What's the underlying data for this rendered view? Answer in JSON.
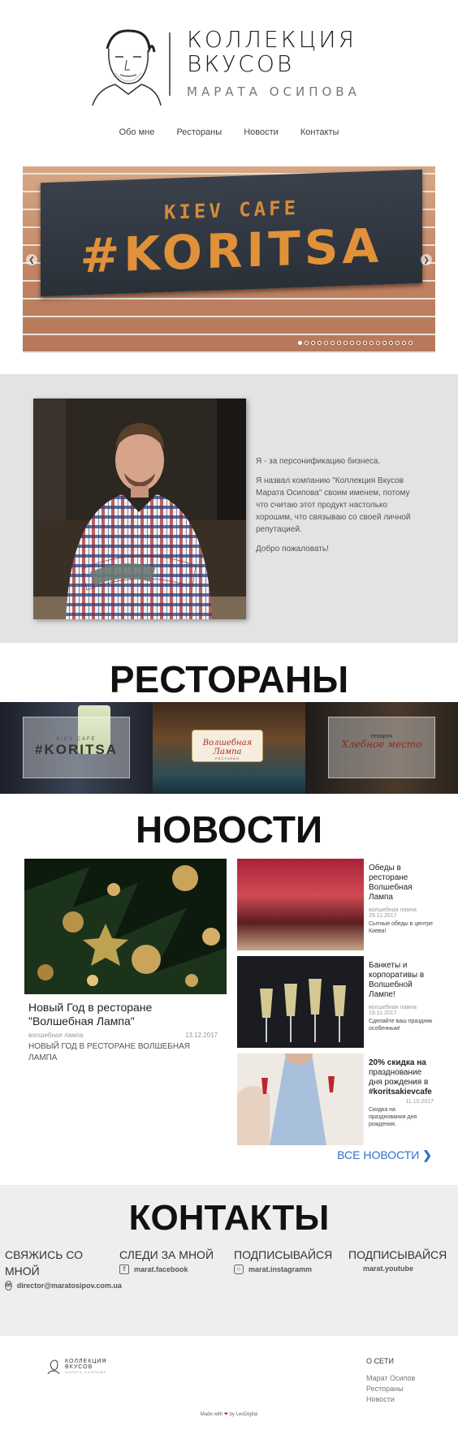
{
  "header": {
    "logo_line1": "КОЛЛЕКЦИЯ",
    "logo_line2": "ВКУСОВ",
    "logo_sub": "МАРАТА ОСИПОВА",
    "nav": [
      "Обо мне",
      "Рестораны",
      "Новости",
      "Контакты"
    ]
  },
  "slider": {
    "sign_small": "KIEV CAFE",
    "sign_big": "#KORITSA",
    "prev_icon": "chevron-left-icon",
    "next_icon": "chevron-right-icon",
    "dots_count": 18,
    "active_dot": 0
  },
  "about": {
    "p1": "Я - за персонификацию бизнеса.",
    "p2": "Я назвал компанию \"Коллекция Вкусов Марата Осипова\" своим именем, потому что считаю этот продукт настолько хорошим, что связываю со своей личной репутацией.",
    "p3": "Добро пожаловать!"
  },
  "restaurants": {
    "title": "РЕСТОРАНЫ",
    "items": [
      {
        "small": "KIEV CAFE",
        "big": "#KORITSA"
      },
      {
        "big": "Волшебная Лампа",
        "small": "РЕСТОРАН"
      },
      {
        "small": "пекарня",
        "big": "Хлебное место"
      }
    ]
  },
  "news": {
    "title": "НОВОСТИ",
    "main": {
      "title": "Новый Год в ресторане \"Волшебная Лампа\"",
      "source": "волшебная лампа",
      "date": "13.12.2017",
      "desc": "НОВЫЙ ГОД В РЕСТОРАНЕ ВОЛШЕБНАЯ ЛАМПА"
    },
    "side": [
      {
        "title": "Обеды в ресторане Волшебная Лампа",
        "source": "волшебная лампа",
        "date": "29.11.2017",
        "desc": "Сытные обеды в центре Киева!"
      },
      {
        "title": "Банкеты и корпоративы в Волшебной Лампе!",
        "source": "волшебная лампа",
        "date": "19.11.2017",
        "desc": "Сделайте ваш праздник особенным!"
      },
      {
        "title_bold": "20% скидка на",
        "title": "празднование дня рождения в",
        "title_tag": "#koritsakievcafe",
        "date": "11.10.2017",
        "desc": "Скидка на празднования дня рождения."
      }
    ],
    "all": "ВСЕ НОВОСТИ"
  },
  "contacts": {
    "title": "КОНТАКТЫ",
    "cols": [
      {
        "head": "СВЯЖИСЬ СО МНОЙ",
        "link": "director@maratosipov.com.ua",
        "icon": "envelope-icon"
      },
      {
        "head": "СЛЕДИ ЗА МНОЙ",
        "link": "marat.facebook",
        "icon": "facebook-icon"
      },
      {
        "head": "ПОДПИСЫВАЙСЯ",
        "link": "marat.instagramm",
        "icon": "instagram-icon"
      },
      {
        "head": "ПОДПИСЫВАЙСЯ",
        "link": "marat.youtube",
        "icon": ""
      }
    ]
  },
  "footer": {
    "logo_line1": "КОЛЛЕКЦИЯ",
    "logo_line2": "ВКУСОВ",
    "logo_sub": "МАРАТА ОСИПОВА",
    "menu_head": "О СЕТИ",
    "menu": [
      "Марат Осипов",
      "Рестораны",
      "Новости"
    ],
    "made_prefix": "Made with",
    "made_suffix": "by LeoDigital"
  }
}
